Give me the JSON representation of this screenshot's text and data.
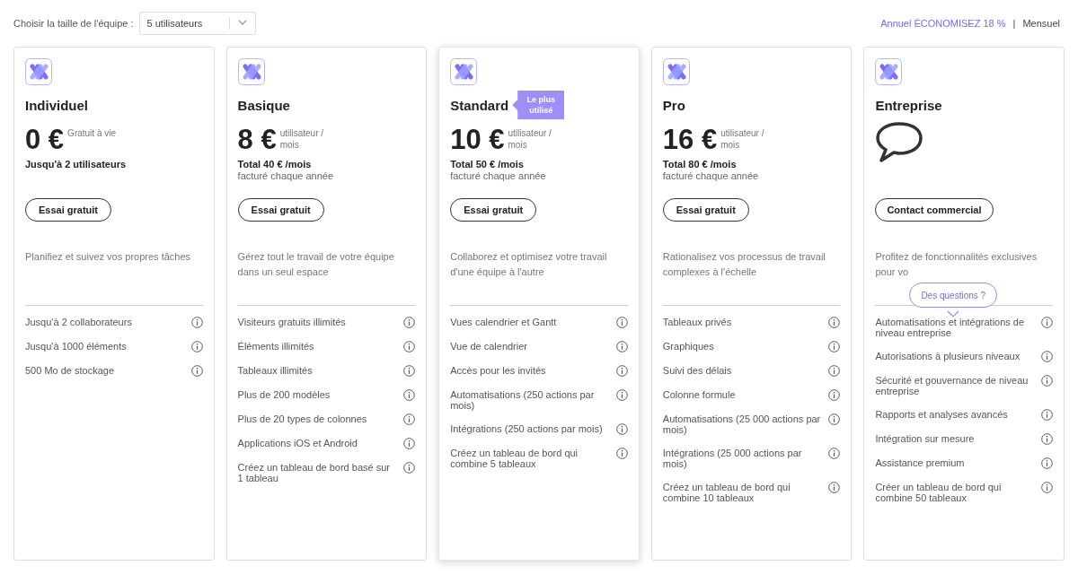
{
  "team_size": {
    "label": "Choisir la taille de l'équipe :",
    "value": "5 utilisateurs"
  },
  "billing": {
    "options": [
      {
        "label": "Annuel ÉCONOMISEZ 18 %",
        "selected": true
      },
      {
        "label": "Mensuel",
        "selected": false
      }
    ],
    "separator": "|"
  },
  "plans": [
    {
      "name": "Individuel",
      "highlighted": false,
      "price": {
        "kind": "amount",
        "amount": "0 €",
        "unit": "Gratuit à vie"
      },
      "total": "Jusqu'à 2 utilisateurs",
      "button": "Essai gratuit",
      "description": "Planifiez et suivez vos propres tâches",
      "features": [
        "Jusqu'à 2 collaborateurs",
        "Jusqu'à 1000 éléments",
        "500 Mo de stockage"
      ]
    },
    {
      "name": "Basique",
      "highlighted": false,
      "price": {
        "kind": "amount",
        "amount": "8 €",
        "unit": "utilisateur / mois"
      },
      "total": "Total 40 € /mois",
      "billed": "facturé chaque année",
      "button": "Essai gratuit",
      "description": "Gérez tout le travail de votre équipe dans un seul espace",
      "features": [
        "Visiteurs gratuits illimités",
        "Éléments illimités",
        "Tableaux illimités",
        "Plus de 200 modèles",
        "Plus de 20 types de colonnes",
        "Applications iOS et Android",
        "Créez un tableau de bord basé sur 1 tableau"
      ]
    },
    {
      "name": "Standard",
      "highlighted": true,
      "badge": "Le plus utilisé",
      "price": {
        "kind": "amount",
        "amount": "10 €",
        "unit": "utilisateur / mois"
      },
      "total": "Total 50 € /mois",
      "billed": "facturé chaque année",
      "button": "Essai gratuit",
      "description": "Collaborez et optimisez votre travail d'une équipe à l'autre",
      "features": [
        "Vues calendrier et Gantt",
        "Vue de calendrier",
        "Accès pour les invités",
        "Automatisations (250 actions par mois)",
        "Intégrations (250 actions par mois)",
        "Créez un tableau de bord qui combine 5 tableaux"
      ]
    },
    {
      "name": "Pro",
      "highlighted": false,
      "price": {
        "kind": "amount",
        "amount": "16 €",
        "unit": "utilisateur / mois"
      },
      "total": "Total 80 € /mois",
      "billed": "facturé chaque année",
      "button": "Essai gratuit",
      "description": "Rationalisez vos processus de travail complexes à l'échelle",
      "features": [
        "Tableaux privés",
        "Graphiques",
        "Suivi des délais",
        "Colonne formule",
        "Automatisations (25 000 actions par mois)",
        "Intégrations (25 000 actions par mois)",
        "Créez un tableau de bord qui combine 10 tableaux"
      ]
    },
    {
      "name": "Entreprise",
      "highlighted": false,
      "price": {
        "kind": "contact"
      },
      "button": "Contact commercial",
      "description": "Profitez de fonctionnalités exclusives pour vo",
      "features": [
        "Automatisations et intégrations de niveau entreprise",
        "Autorisations à plusieurs niveaux",
        "Sécurité et gouvernance de niveau entreprise",
        "Rapports et analyses avancés",
        "Intégration sur mesure",
        "Assistance premium",
        "Créer un tableau de bord qui combine 50 tableaux"
      ]
    }
  ],
  "help_bubble": "Des questions ?"
}
